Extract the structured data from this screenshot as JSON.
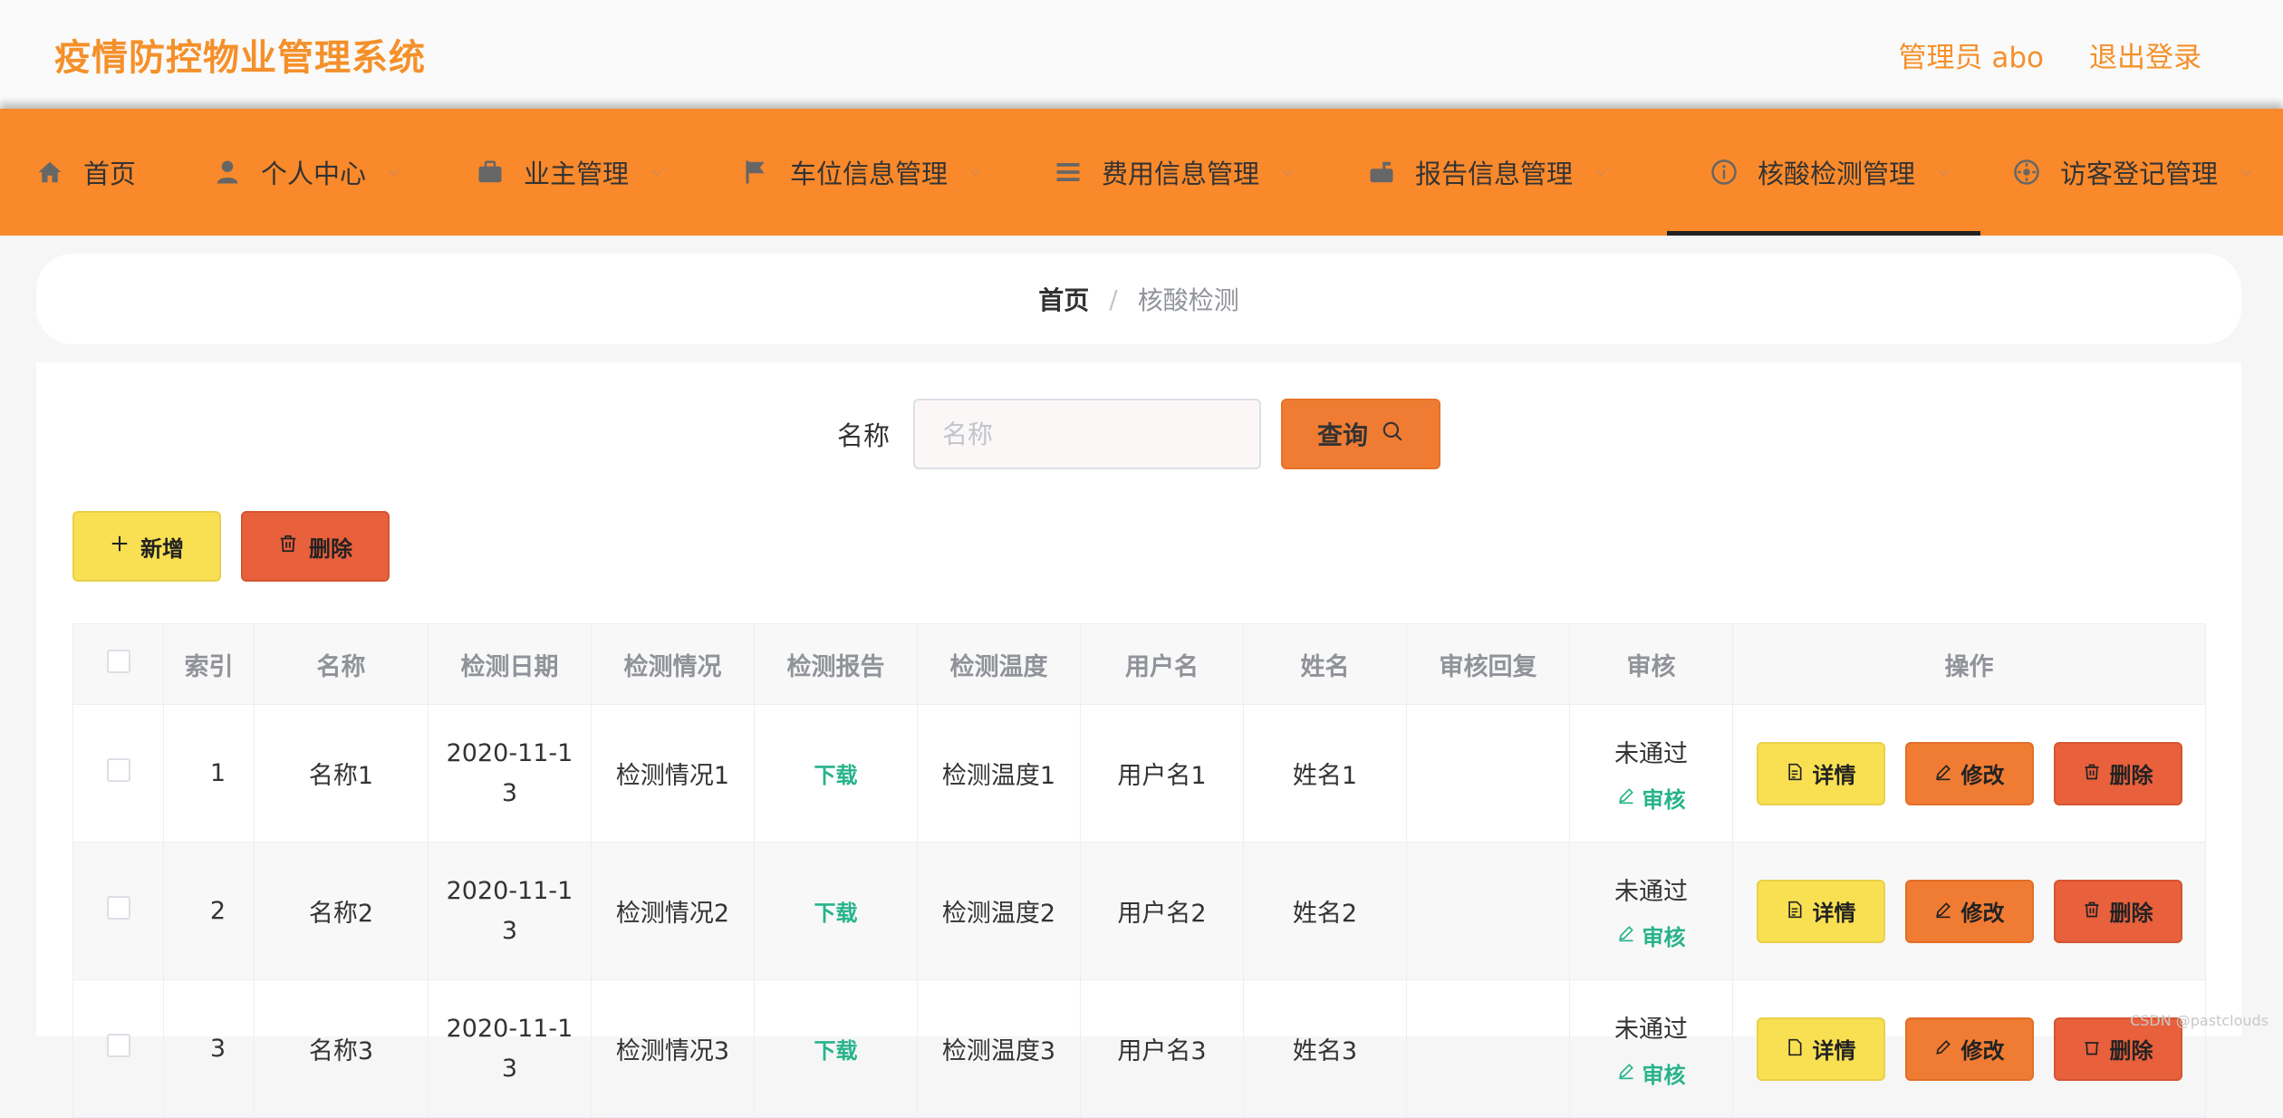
{
  "header": {
    "app_title": "疫情防控物业管理系统",
    "admin_label": "管理员 abo",
    "logout_label": "退出登录"
  },
  "nav": {
    "items": [
      {
        "label": "首页",
        "icon": "home-icon"
      },
      {
        "label": "个人中心",
        "icon": "user-icon"
      },
      {
        "label": "业主管理",
        "icon": "briefcase-icon"
      },
      {
        "label": "车位信息管理",
        "icon": "flag-icon"
      },
      {
        "label": "费用信息管理",
        "icon": "list-icon"
      },
      {
        "label": "报告信息管理",
        "icon": "mailbox-icon"
      },
      {
        "label": "核酸检测管理",
        "icon": "info-circle-icon"
      },
      {
        "label": "访客登记管理",
        "icon": "sun-icon"
      }
    ],
    "active_index": 6
  },
  "breadcrumb": {
    "home": "首页",
    "separator": "/",
    "current": "核酸检测"
  },
  "search": {
    "label": "名称",
    "placeholder": "名称",
    "value": "",
    "button_label": "查询"
  },
  "actions": {
    "add_label": "新增",
    "delete_label": "删除"
  },
  "table": {
    "columns": [
      "索引",
      "名称",
      "检测日期",
      "检测情况",
      "检测报告",
      "检测温度",
      "用户名",
      "姓名",
      "审核回复",
      "审核",
      "操作"
    ],
    "rows": [
      {
        "index": "1",
        "name": "名称1",
        "date": "2020-11-13",
        "status": "检测情况1",
        "report": "下载",
        "temperature": "检测温度1",
        "username": "用户名1",
        "realname": "姓名1",
        "reply": "",
        "audit_status": "未通过",
        "audit_action": "审核"
      },
      {
        "index": "2",
        "name": "名称2",
        "date": "2020-11-13",
        "status": "检测情况2",
        "report": "下载",
        "temperature": "检测温度2",
        "username": "用户名2",
        "realname": "姓名2",
        "reply": "",
        "audit_status": "未通过",
        "audit_action": "审核"
      },
      {
        "index": "3",
        "name": "名称3",
        "date": "2020-11-13",
        "status": "检测情况3",
        "report": "下载",
        "temperature": "检测温度3",
        "username": "用户名3",
        "realname": "姓名3",
        "reply": "",
        "audit_status": "未通过",
        "audit_action": "审核"
      }
    ],
    "row_actions": {
      "detail_label": "详情",
      "edit_label": "修改",
      "delete_label": "删除"
    }
  },
  "watermark": "CSDN @pastclouds",
  "colors": {
    "accent": "#f9892b",
    "title": "#f5902a",
    "success": "#27b38a",
    "danger": "#e8603c",
    "warning": "#f9e052"
  }
}
